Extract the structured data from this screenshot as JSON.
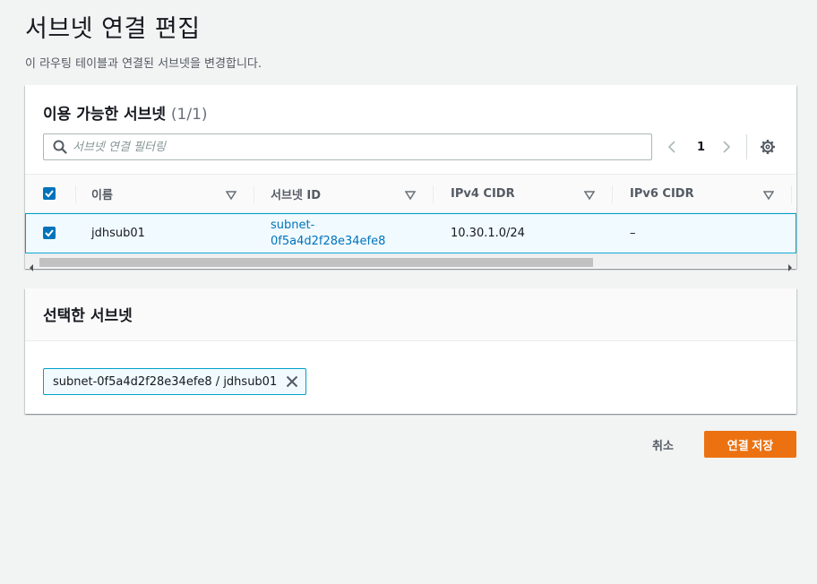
{
  "page": {
    "title": "서브넷 연결 편집",
    "description": "이 라우팅 테이블과 연결된 서브넷을 변경합니다."
  },
  "available_panel": {
    "title": "이용 가능한 서브넷",
    "count": "(1/1)",
    "search_placeholder": "서브넷 연결 필터링",
    "current_page": "1",
    "columns": [
      "이름",
      "서브넷 ID",
      "IPv4 CIDR",
      "IPv6 CIDR"
    ],
    "rows": [
      {
        "checked": true,
        "name": "jdhsub01",
        "subnet_id_line1": "subnet-",
        "subnet_id_line2": "0f5a4d2f28e34efe8",
        "ipv4": "10.30.1.0/24",
        "ipv6": "–"
      }
    ]
  },
  "selected_panel": {
    "title": "선택한 서브넷",
    "tokens": [
      "subnet-0f5a4d2f28e34efe8 / jdhsub01"
    ]
  },
  "actions": {
    "cancel_label": "취소",
    "save_label": "연결 저장"
  },
  "colors": {
    "accent": "#0073bb",
    "primary_button": "#ec7211",
    "selection_border": "#00a1c9"
  }
}
